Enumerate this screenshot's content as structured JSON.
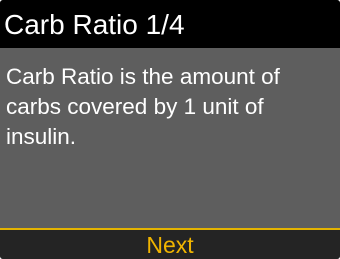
{
  "header": {
    "title": "Carb Ratio 1/4"
  },
  "main": {
    "lines": [
      "Carb Ratio is the amount of",
      "carbs covered by 1 unit of",
      "insulin."
    ]
  },
  "footer": {
    "next_label": "Next"
  },
  "colors": {
    "title_background": "#000000",
    "body_background": "#5e5e5e",
    "footer_background": "#242424",
    "accent": "#e3b300"
  }
}
